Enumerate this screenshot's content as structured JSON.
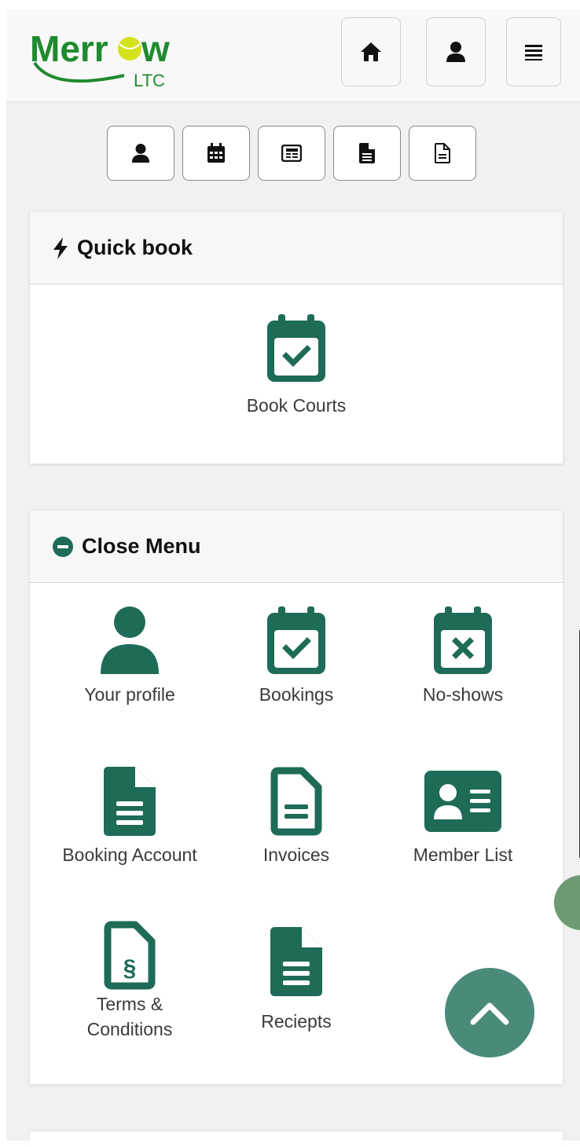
{
  "header": {
    "logo_text": "Merrow",
    "logo_sub": "LTC",
    "buttons": [
      {
        "icon": "home-icon"
      },
      {
        "icon": "user-icon"
      },
      {
        "icon": "menu-icon"
      }
    ]
  },
  "quick_nav": [
    {
      "icon": "user-icon"
    },
    {
      "icon": "calendar-icon"
    },
    {
      "icon": "newspaper-icon"
    },
    {
      "icon": "file-text-icon"
    },
    {
      "icon": "file-outline-icon"
    }
  ],
  "quick_book": {
    "title": "Quick book",
    "icon": "bolt-icon",
    "item": {
      "label": "Book Courts",
      "icon": "calendar-check-icon"
    }
  },
  "menu": {
    "title": "Close Menu",
    "icon": "minus-circle-icon",
    "items": [
      {
        "label": "Your profile",
        "icon": "user-icon"
      },
      {
        "label": "Bookings",
        "icon": "calendar-check-icon"
      },
      {
        "label": "No-shows",
        "icon": "calendar-x-icon"
      },
      {
        "label": "Booking Account",
        "icon": "file-text-icon"
      },
      {
        "label": "Invoices",
        "icon": "file-outline-icon"
      },
      {
        "label": "Member List",
        "icon": "id-card-icon"
      },
      {
        "label": "Terms &",
        "label2": "Conditions",
        "icon": "file-section-icon"
      },
      {
        "label": "Reciepts",
        "icon": "file-text-icon"
      }
    ]
  },
  "colors": {
    "brand_green": "#1e6b57",
    "logo_green": "#1f8a2f",
    "ball_yellow": "#d4e21b"
  }
}
